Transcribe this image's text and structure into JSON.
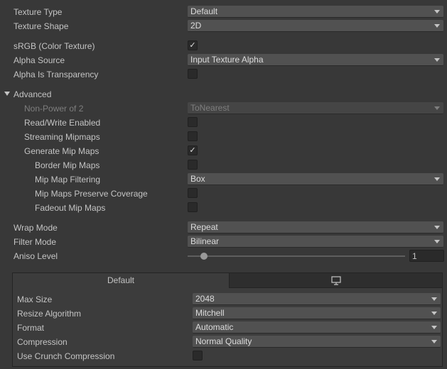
{
  "fields": [
    {
      "label": "Texture Type",
      "type": "dropdown",
      "value": "Default"
    },
    {
      "label": "Texture Shape",
      "type": "dropdown",
      "value": "2D"
    },
    {
      "label": "sRGB (Color Texture)",
      "type": "checkbox",
      "checked": true
    },
    {
      "label": "Alpha Source",
      "type": "dropdown",
      "value": "Input Texture Alpha"
    },
    {
      "label": "Alpha Is Transparency",
      "type": "checkbox",
      "checked": false
    }
  ],
  "advanced": {
    "label": "Advanced",
    "expanded": true,
    "fields": [
      {
        "label": "Non-Power of 2",
        "type": "dropdown",
        "value": "ToNearest",
        "disabled": true
      },
      {
        "label": "Read/Write Enabled",
        "type": "checkbox",
        "checked": false
      },
      {
        "label": "Streaming Mipmaps",
        "type": "checkbox",
        "checked": false
      },
      {
        "label": "Generate Mip Maps",
        "type": "checkbox",
        "checked": true
      },
      {
        "label": "Border Mip Maps",
        "type": "checkbox",
        "checked": false
      },
      {
        "label": "Mip Map Filtering",
        "type": "dropdown",
        "value": "Box"
      },
      {
        "label": "Mip Maps Preserve Coverage",
        "type": "checkbox",
        "checked": false
      },
      {
        "label": "Fadeout Mip Maps",
        "type": "checkbox",
        "checked": false
      }
    ]
  },
  "wrap": {
    "label": "Wrap Mode",
    "value": "Repeat"
  },
  "filter": {
    "label": "Filter Mode",
    "value": "Bilinear"
  },
  "aniso": {
    "label": "Aniso Level",
    "value": "1",
    "min": 0,
    "max": 16
  },
  "platform": {
    "tabs": [
      {
        "label": "Default",
        "active": true
      },
      {
        "icon": "monitor-icon",
        "active": false
      }
    ],
    "fields": [
      {
        "label": "Max Size",
        "type": "dropdown",
        "value": "2048"
      },
      {
        "label": "Resize Algorithm",
        "type": "dropdown",
        "value": "Mitchell"
      },
      {
        "label": "Format",
        "type": "dropdown",
        "value": "Automatic"
      },
      {
        "label": "Compression",
        "type": "dropdown",
        "value": "Normal Quality"
      },
      {
        "label": "Use Crunch Compression",
        "type": "checkbox",
        "checked": false
      }
    ]
  }
}
